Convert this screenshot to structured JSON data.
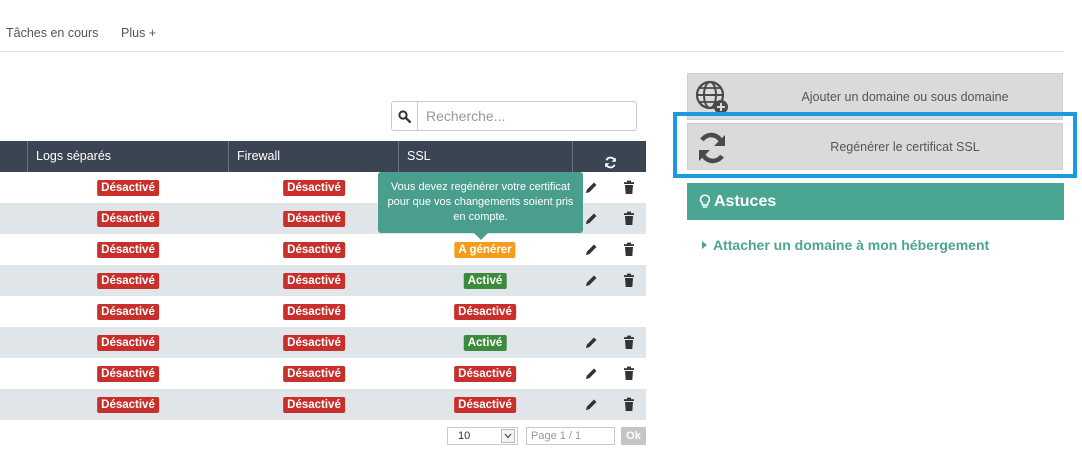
{
  "nav": {
    "tabs": [
      "Tâches en cours",
      "Plus +"
    ]
  },
  "search": {
    "placeholder": "Recherche...",
    "icon": "search-icon"
  },
  "table": {
    "headers": [
      "Logs séparés",
      "Firewall",
      "SSL"
    ],
    "refresh_icon": "refresh-icon",
    "rows": [
      {
        "logs": "Désactivé",
        "firewall": "Désactivé",
        "ssl": "",
        "ssl_status": "hidden",
        "actions": true
      },
      {
        "logs": "Désactivé",
        "firewall": "Désactivé",
        "ssl": "",
        "ssl_status": "hidden",
        "actions": true
      },
      {
        "logs": "Désactivé",
        "firewall": "Désactivé",
        "ssl": "A générer",
        "ssl_status": "gen",
        "actions": true
      },
      {
        "logs": "Désactivé",
        "firewall": "Désactivé",
        "ssl": "Activé",
        "ssl_status": "on",
        "actions": true
      },
      {
        "logs": "Désactivé",
        "firewall": "Désactivé",
        "ssl": "Désactivé",
        "ssl_status": "off",
        "actions": false
      },
      {
        "logs": "Désactivé",
        "firewall": "Désactivé",
        "ssl": "Activé",
        "ssl_status": "on",
        "actions": true
      },
      {
        "logs": "Désactivé",
        "firewall": "Désactivé",
        "ssl": "Désactivé",
        "ssl_status": "off",
        "actions": true
      },
      {
        "logs": "Désactivé",
        "firewall": "Désactivé",
        "ssl": "Désactivé",
        "ssl_status": "off",
        "actions": true
      }
    ]
  },
  "tooltip": {
    "text": "Vous devez regénérer votre certificat pour que vos changements soient pris en compte."
  },
  "pagination": {
    "per_page": "10",
    "page_placeholder": "Page 1 / 1",
    "ok_label": "Ok"
  },
  "sidebar": {
    "add_domain_label": "Ajouter un domaine ou sous domaine",
    "regen_ssl_label": "Regénérer le certificat SSL",
    "astuces_title": "Astuces",
    "tip_link": "Attacher un domaine à mon hébergement"
  },
  "colors": {
    "header_bg": "#3b4452",
    "disabled_badge": "#c9302c",
    "enabled_badge": "#3c8b3c",
    "generate_badge": "#f59c1a",
    "teal_accent": "#4aa593",
    "highlight_border": "#1a9be0"
  }
}
